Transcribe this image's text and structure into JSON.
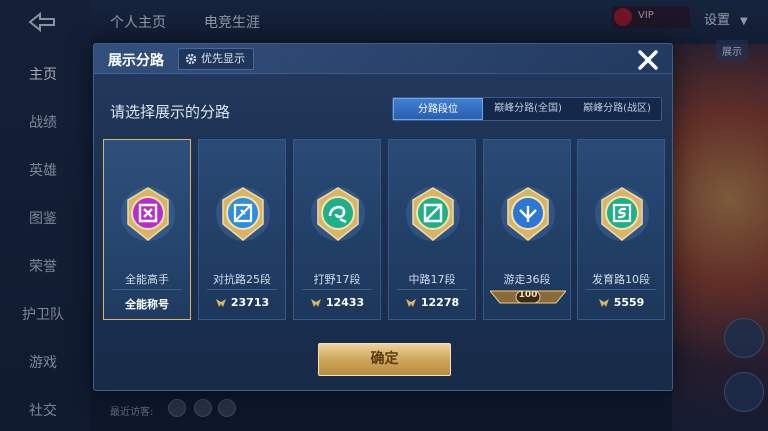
{
  "background": {
    "sidebar": [
      "主页",
      "战绩",
      "英雄",
      "图鉴",
      "荣誉",
      "护卫队",
      "游戏",
      "社交"
    ],
    "top_tabs": [
      "个人主页",
      "电竞生涯"
    ],
    "user_name": "VIP",
    "settings_label": "设置",
    "right_button": "展示",
    "recent_label": "最近访客:"
  },
  "modal": {
    "title": "展示分路",
    "priority_label": "优先显示",
    "subtitle": "请选择展示的分路",
    "tabs": [
      "分路段位",
      "巅峰分路(全国)",
      "巅峰分路(战区)"
    ],
    "active_tab": 0,
    "cards": [
      {
        "rank": "全能高手",
        "score": "全能称号",
        "has_icon": false,
        "selected": true,
        "color": "#b72ccf"
      },
      {
        "rank": "对抗路25段",
        "score": "23713",
        "has_icon": true,
        "selected": false,
        "color": "#2f8de0"
      },
      {
        "rank": "打野17段",
        "score": "12433",
        "has_icon": true,
        "selected": false,
        "color": "#1fb08a"
      },
      {
        "rank": "中路17段",
        "score": "12278",
        "has_icon": true,
        "selected": false,
        "color": "#1fb08a"
      },
      {
        "rank": "游走36段",
        "score": "",
        "badge": "100",
        "has_icon": false,
        "selected": false,
        "color": "#2a77d8"
      },
      {
        "rank": "发育路10段",
        "score": "5559",
        "has_icon": true,
        "selected": false,
        "color": "#1fb08a"
      }
    ],
    "confirm_label": "确定"
  },
  "colors": {
    "gold": "#d9b56a",
    "accent_blue": "#3f7fd1"
  }
}
